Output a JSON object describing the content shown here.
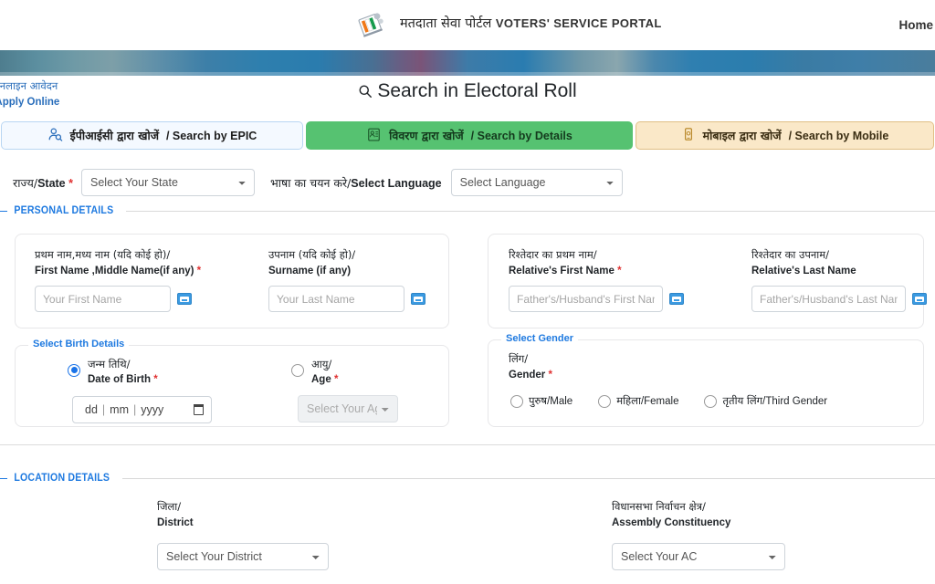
{
  "header": {
    "brand_hindi": "मतदाता सेवा पोर्टल",
    "brand_english": "VOTERS' SERVICE PORTAL",
    "logo_icon": "eci-ballot-logo-icon",
    "home_label": "Home"
  },
  "apply_online": {
    "hindi": "ऑनलाइन आवेदन",
    "english": "/ Apply Online"
  },
  "page": {
    "heading": "Search in Electoral Roll",
    "search_icon": "magnifier-icon"
  },
  "tabs": [
    {
      "id": "epic",
      "icon": "person-search-icon",
      "hindi": "ईपीआईसी द्वारा खोजें",
      "english": "/ Search by EPIC",
      "active": false,
      "bg": "#f4f9ff",
      "border": "#b9d6f2"
    },
    {
      "id": "details",
      "icon": "id-card-icon",
      "hindi": "विवरण द्वारा खोजें",
      "english": "/ Search by Details",
      "active": true,
      "bg": "#56c271",
      "border": "#56c271"
    },
    {
      "id": "mobile",
      "icon": "mobile-phone-icon",
      "hindi": "मोबाइल द्वारा खोजें",
      "english": "/ Search by Mobile",
      "active": false,
      "bg": "#fae8c8",
      "border": "#e0bf84"
    }
  ],
  "top_row": {
    "state": {
      "label_hindi": "राज्य/",
      "label_english": "State",
      "required": "*",
      "value": "Select Your State"
    },
    "language": {
      "label_hindi": "भाषा का चयन करे/",
      "label_english": "Select Language",
      "value": "Select Language"
    }
  },
  "sections": {
    "personal": "PERSONAL DETAILS",
    "location": "LOCATION DETAILS"
  },
  "personal": {
    "first_name": {
      "label_hindi": "प्रथम नाम,मध्य नाम (यदि कोई हो)/",
      "label_english": "First Name ,Middle Name(if any)",
      "required": "*",
      "placeholder": "Your First Name",
      "value": "",
      "keyboard_icon": "virtual-keyboard-icon"
    },
    "surname": {
      "label_hindi": "उपनाम (यदि कोई हो)/",
      "label_english": "Surname (if any)",
      "required": "",
      "placeholder": "Your Last Name",
      "value": "",
      "keyboard_icon": "virtual-keyboard-icon"
    },
    "relative_first_name": {
      "label_hindi": "रिश्तेदार का प्रथम नाम/",
      "label_english": "Relative's First Name",
      "required": "*",
      "placeholder": "Father's/Husband's First Name",
      "value": "",
      "keyboard_icon": "virtual-keyboard-icon"
    },
    "relative_last_name": {
      "label_hindi": "रिश्तेदार का उपनाम/",
      "label_english": "Relative's Last Name",
      "required": "",
      "placeholder": "Father's/Husband's Last Name",
      "value": "",
      "keyboard_icon": "virtual-keyboard-icon"
    }
  },
  "birth": {
    "legend": "Select Birth Details",
    "dob": {
      "label_hindi": "जन्म तिथि/",
      "label_english": "Date of Birth",
      "required": "*",
      "selected": true,
      "day_placeholder": "dd",
      "month_placeholder": "mm",
      "year_placeholder": "yyyy",
      "calendar_icon": "calendar-icon"
    },
    "age": {
      "label_hindi": "आयु/",
      "label_english": "Age",
      "required": "*",
      "selected": false,
      "value": "Select Your Age",
      "disabled": true
    }
  },
  "gender": {
    "legend": "Select Gender",
    "label_hindi": "लिंग/",
    "label_english": "Gender",
    "required": "*",
    "options": [
      {
        "hindi": "पुरुष",
        "english": "/Male",
        "selected": false
      },
      {
        "hindi": "महिला",
        "english": "/Female",
        "selected": false
      },
      {
        "hindi": "तृतीय लिंग",
        "english": "/Third Gender",
        "selected": false
      }
    ]
  },
  "location": {
    "district": {
      "label_hindi": "जिला/",
      "label_english": "District",
      "value": "Select Your District"
    },
    "assembly": {
      "label_hindi": "विधानसभा निर्वाचन क्षेत्र/",
      "label_english": "Assembly Constituency",
      "value": "Select Your AC"
    }
  },
  "colors": {
    "accent_blue": "#1f7ae0",
    "tab_green": "#56c271",
    "tab_cream": "#fae8c8",
    "required_red": "#e03131",
    "banner_blue": "#2a7cae"
  }
}
